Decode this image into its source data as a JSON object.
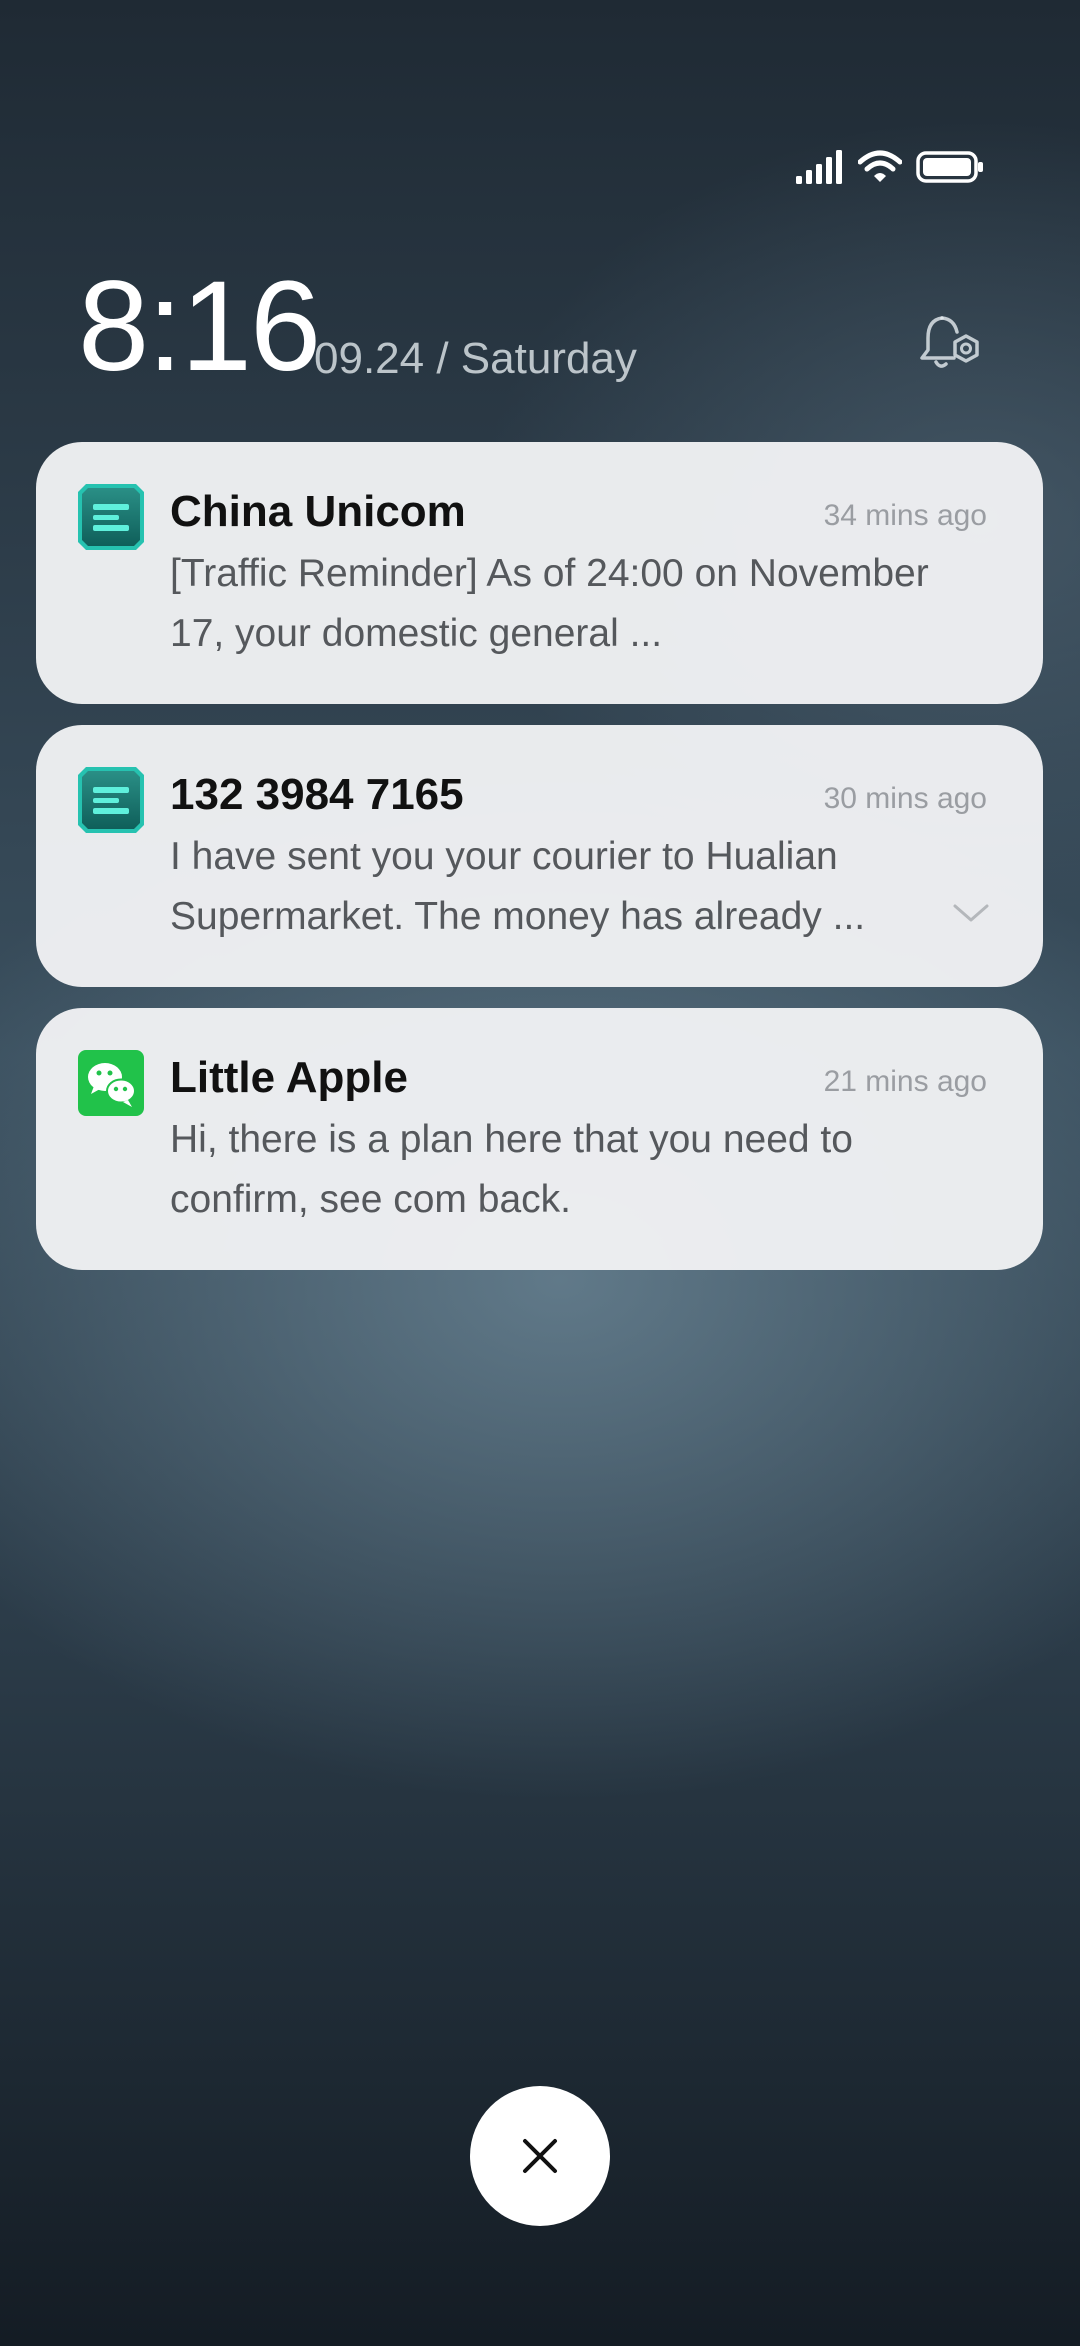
{
  "status_bar": {
    "signal_icon": "signal-icon",
    "wifi_icon": "wifi-icon",
    "battery_icon": "battery-icon"
  },
  "lockscreen": {
    "time": "8:16",
    "date": "09.24 / Saturday",
    "notification_settings_icon": "bell-settings-icon"
  },
  "notifications": [
    {
      "app_icon": "messages-icon",
      "title": "China Unicom",
      "time": "34 mins ago",
      "body": "[Traffic Reminder] As of 24:00 on November 17, your domestic general ..."
    },
    {
      "app_icon": "messages-icon",
      "title": "132 3984 7165",
      "time": "30 mins ago",
      "body": "I have sent you your courier to Hualian Supermarket. The money has already ...",
      "expand_icon": "chevron-down-icon"
    },
    {
      "app_icon": "wechat-icon",
      "title": "Little Apple",
      "time": "21 mins ago",
      "body": "Hi, there is a plan here that you need to confirm, see com back."
    }
  ],
  "clear_button": {
    "icon": "close-icon"
  },
  "colors": {
    "messages_accent": "#1fa89a",
    "wechat_green": "#21c24a",
    "card_bg": "#f0f1f3"
  }
}
